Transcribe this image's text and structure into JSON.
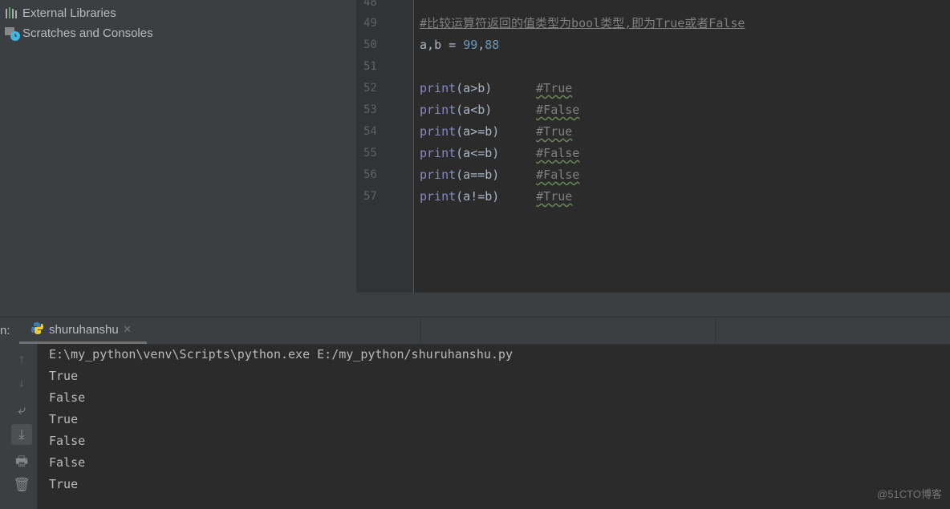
{
  "project_tree": {
    "items": [
      {
        "label": "External Libraries",
        "icon": "library-icon"
      },
      {
        "label": "Scratches and Consoles",
        "icon": "scratches-icon"
      }
    ]
  },
  "editor": {
    "line_numbers": [
      "48",
      "49",
      "50",
      "51",
      "52",
      "53",
      "54",
      "55",
      "56",
      "57"
    ],
    "comment_line": "#比较运算符返回的值类型为bool类型,即为True或者False",
    "assign": {
      "a": "a",
      "comma1": ",",
      "b": "b = ",
      "v1": "99",
      "comma2": ",",
      "v2": "88"
    },
    "prints": [
      {
        "fn": "print",
        "arg": "(a>b)",
        "comment": "#True"
      },
      {
        "fn": "print",
        "arg": "(a<b)",
        "comment": "#False"
      },
      {
        "fn": "print",
        "arg": "(a>=b)",
        "comment": "#True"
      },
      {
        "fn": "print",
        "arg": "(a<=b)",
        "comment": "#False"
      },
      {
        "fn": "print",
        "arg": "(a==b)",
        "comment": "#False"
      },
      {
        "fn": "print",
        "arg": "(a!=b)",
        "comment": "#True"
      }
    ]
  },
  "run": {
    "label": "n:",
    "tab": "shuruhanshu",
    "close": "×"
  },
  "console": {
    "lines": [
      "E:\\my_python\\venv\\Scripts\\python.exe E:/my_python/shuruhanshu.py",
      "True",
      "False",
      "True",
      "False",
      "False",
      "True"
    ]
  },
  "watermark": "@51CTO博客"
}
